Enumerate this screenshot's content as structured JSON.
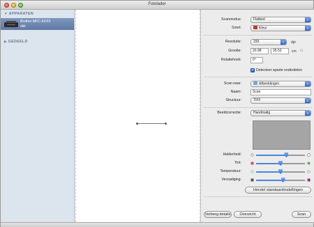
{
  "window": {
    "title": "Fotolader"
  },
  "sidebar": {
    "devices_header": "APPARATEN",
    "shared_header": "GEDEELD",
    "device_name_line1": "Brother MFC-XXXX",
    "device_name_line2": "dsk"
  },
  "panel": {
    "scanmodus": {
      "label": "Scanmodus:",
      "value": "Flatbed"
    },
    "soort": {
      "label": "Soort:",
      "value": "Kleur"
    },
    "resolutie": {
      "label": "Resolutie:",
      "value": "150",
      "unit": "dpi"
    },
    "grootte": {
      "label": "Grootte:",
      "width": "20.98",
      "height": "35.53",
      "unit": "cm"
    },
    "rotatiehoek": {
      "label": "Rotatiehoek:",
      "value": "0°"
    },
    "detect_separate": {
      "label": "Detecteer aparte onderdelen",
      "checked": true
    },
    "scan_naar": {
      "label": "Scan naar:",
      "value": "Afbeeldingen"
    },
    "naam": {
      "label": "Naam:",
      "value": "Scan"
    },
    "structuur": {
      "label": "Structuur:",
      "value": "TIFF"
    },
    "beeldcorrectie": {
      "label": "Beeldcorrectie:",
      "value": "Handmatig"
    },
    "sliders": [
      {
        "label": "Helderheid:",
        "value": 0.62
      },
      {
        "label": "Tint:",
        "value": 0.5
      },
      {
        "label": "Temperatuur:",
        "value": 0.5
      },
      {
        "label": "Verzadiging:",
        "value": 0.55
      }
    ],
    "reset_button": "Herstel standaardinstellingen"
  },
  "footer": {
    "hide_details": "Verberg details",
    "overview": "Overzicht",
    "scan": "Scan"
  },
  "colors": {
    "accent": "#2a64c9",
    "sidebar_bg": "#dce4ee",
    "selection": "#6a84b0"
  }
}
